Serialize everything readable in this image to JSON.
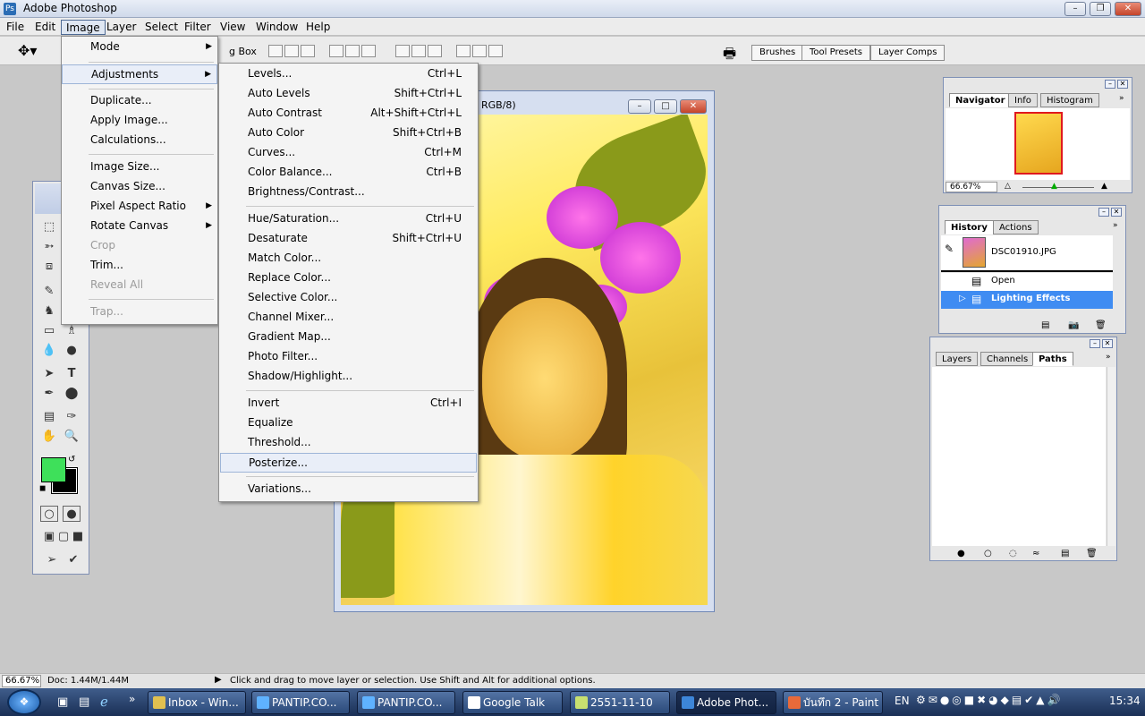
{
  "window": {
    "title": "Adobe Photoshop"
  },
  "menubar": [
    "File",
    "Edit",
    "Image",
    "Layer",
    "Select",
    "Filter",
    "View",
    "Window",
    "Help"
  ],
  "options": {
    "checkbox_partial": "g Box"
  },
  "palette_well": {
    "tabs": [
      "Brushes",
      "Tool Presets",
      "Layer Comps"
    ]
  },
  "document": {
    "title_partial": "RGB/8)"
  },
  "image_menu": {
    "items": [
      {
        "label": "Mode",
        "submenu": true
      },
      {
        "label": "Adjustments",
        "submenu": true
      },
      {
        "label": "Duplicate..."
      },
      {
        "label": "Apply Image..."
      },
      {
        "label": "Calculations..."
      },
      {
        "label": "Image Size..."
      },
      {
        "label": "Canvas Size..."
      },
      {
        "label": "Pixel Aspect Ratio",
        "submenu": true
      },
      {
        "label": "Rotate Canvas",
        "submenu": true
      },
      {
        "label": "Crop"
      },
      {
        "label": "Trim..."
      },
      {
        "label": "Reveal All"
      },
      {
        "label": "Trap..."
      }
    ]
  },
  "adjustments_menu": {
    "items": [
      {
        "label": "Levels...",
        "shortcut": "Ctrl+L"
      },
      {
        "label": "Auto Levels",
        "shortcut": "Shift+Ctrl+L"
      },
      {
        "label": "Auto Contrast",
        "shortcut": "Alt+Shift+Ctrl+L"
      },
      {
        "label": "Auto Color",
        "shortcut": "Shift+Ctrl+B"
      },
      {
        "label": "Curves...",
        "shortcut": "Ctrl+M"
      },
      {
        "label": "Color Balance...",
        "shortcut": "Ctrl+B"
      },
      {
        "label": "Brightness/Contrast...",
        "shortcut": ""
      },
      {
        "label": "Hue/Saturation...",
        "shortcut": "Ctrl+U"
      },
      {
        "label": "Desaturate",
        "shortcut": "Shift+Ctrl+U"
      },
      {
        "label": "Match Color...",
        "shortcut": ""
      },
      {
        "label": "Replace Color...",
        "shortcut": ""
      },
      {
        "label": "Selective Color...",
        "shortcut": ""
      },
      {
        "label": "Channel Mixer...",
        "shortcut": ""
      },
      {
        "label": "Gradient Map...",
        "shortcut": ""
      },
      {
        "label": "Photo Filter...",
        "shortcut": ""
      },
      {
        "label": "Shadow/Highlight...",
        "shortcut": ""
      },
      {
        "label": "Invert",
        "shortcut": "Ctrl+I"
      },
      {
        "label": "Equalize",
        "shortcut": ""
      },
      {
        "label": "Threshold...",
        "shortcut": ""
      },
      {
        "label": "Posterize...",
        "shortcut": ""
      },
      {
        "label": "Variations...",
        "shortcut": ""
      }
    ]
  },
  "navigator": {
    "tabs": [
      "Navigator",
      "Info",
      "Histogram"
    ],
    "zoom": "66.67%"
  },
  "history": {
    "tabs": [
      "History",
      "Actions"
    ],
    "snapshot": "DSC01910.JPG",
    "states": [
      "Open",
      "Lighting Effects"
    ]
  },
  "layers": {
    "tabs": [
      "Layers",
      "Channels",
      "Paths"
    ]
  },
  "status": {
    "zoom": "66.67%",
    "doc": "Doc: 1.44M/1.44M",
    "hint": "Click and drag to move layer or selection.  Use Shift and Alt for additional options."
  },
  "taskbar": {
    "items": [
      "Inbox - Win...",
      "PANTIP.CO...",
      "PANTIP.CO...",
      "Google Talk",
      "2551-11-10",
      "Adobe Phot...",
      "บันทึก 2 - Paint"
    ],
    "lang": "EN",
    "clock": "15:34"
  },
  "colors": {
    "foreground": "#3ee05a",
    "background": "#000000",
    "selection": "#3f8cf2"
  }
}
